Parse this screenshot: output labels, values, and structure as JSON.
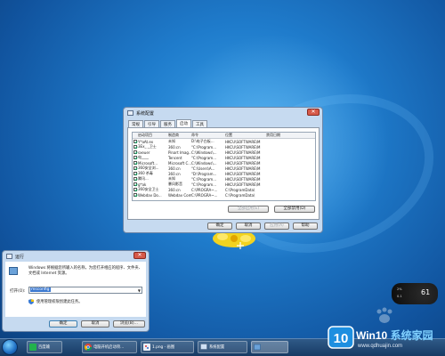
{
  "colors": {
    "desktop": "#1f7ccc",
    "dialog_frame": "#c6daf0",
    "selection": "#3a78d0",
    "close_button": "#d65a4a",
    "brand_blue": "#7fd0ff"
  },
  "msconfig": {
    "title": "系统配置",
    "close_glyph": "✕",
    "tabs": [
      "常规",
      "引导",
      "服务",
      "启动",
      "工具"
    ],
    "active_tab_index": 3,
    "columns": [
      "启动项目",
      "制造商",
      "命令",
      "位置",
      "禁用日期"
    ],
    "rows": [
      {
        "name": "Y*aAt.ex",
        "maker": "未知",
        "command": "D:\\电子白板...",
        "location": "HKCU\\SOFTWARE\\M"
      },
      {
        "name": "3Ex_ _卫士",
        "maker": "360.cn",
        "command": "\"C:\\Program...",
        "location": "HKCU\\SOFTWARE\\M"
      },
      {
        "name": "sxeuer",
        "maker": "Pinart Imag...",
        "command": "C:\\Windows\\...",
        "location": "HKCU\\SOFTWARE\\M"
      },
      {
        "name": "电____",
        "maker": "Tencent",
        "command": "\"C:\\Program...",
        "location": "HKCU\\SOFTWARE\\M"
      },
      {
        "name": "Microsoft...",
        "maker": "Microsoft C...",
        "command": "C:\\Windows\\...",
        "location": "HKCU\\SOFTWARE\\M"
      },
      {
        "name": "360安全浏...",
        "maker": "360.cn",
        "command": "\"C:\\Users\\A...",
        "location": "HKCU\\SOFTWARE\\M"
      },
      {
        "name": "360 杀毒",
        "maker": "360.cn",
        "command": "\"D:\\Program...",
        "location": "HKCU\\SOFTWARE\\M"
      },
      {
        "name": "腾讯...",
        "maker": "未知",
        "command": "\"C:\\Program...",
        "location": "HKCU\\SOFTWARE\\M"
      },
      {
        "name": "g*ak",
        "maker": "暴风影音",
        "command": "\"C:\\Program...",
        "location": "HKCU\\SOFTWARE\\M"
      },
      {
        "name": "360安全卫士",
        "maker": "360.cn",
        "command": "C:\\PROGRA~...",
        "location": "C:\\ProgramData\\"
      },
      {
        "name": "Webdav Do...",
        "maker": "Webdav Com...",
        "command": "C:\\PROGRA~...",
        "location": "C:\\ProgramData\\"
      }
    ],
    "enable_all_label": "全部启用(E)",
    "disable_all_label": "全部禁用(D)",
    "ok_label": "确定",
    "cancel_label": "取消",
    "apply_label": "应用(A)",
    "help_label": "帮助"
  },
  "run": {
    "title": "运行",
    "close_glyph": "✕",
    "description": "Windows 将根据您所输入的名称，为您打开相应的程序、文件夹、文档或 Internet 资源。",
    "open_label": "打开(O):",
    "open_value": "msconfig",
    "admin_text": "使用管理权限创建此任务。",
    "ok_label": "确定",
    "cancel_label": "取消",
    "browse_label": "浏览(B)..."
  },
  "gadget": {
    "big": "61",
    "line1": "2%",
    "line2": "0.1"
  },
  "taskbar": {
    "items": [
      {
        "label": "百度输",
        "icon": "iqiyi-icon"
      },
      {
        "label": "电脑开机启动项...",
        "icon": "chrome-icon"
      },
      {
        "label": "1.png - 画图",
        "icon": "paint-icon"
      },
      {
        "label": "系统配置",
        "icon": "msconfig-icon"
      },
      {
        "label": "",
        "icon": "run-icon"
      }
    ]
  },
  "brand": {
    "name_white": "Win10 ",
    "name_blue": "系统家园",
    "url": "www.qdhuajin.com"
  }
}
